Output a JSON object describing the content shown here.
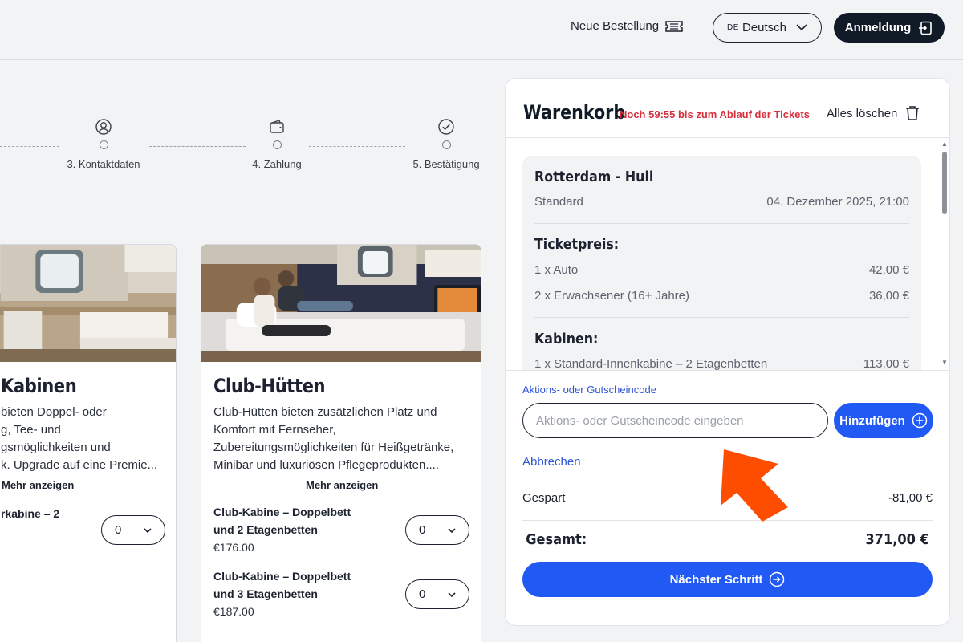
{
  "header": {
    "new_order_label": "Neue Bestellung",
    "lang_code": "DE",
    "lang_label": "Deutsch",
    "login_label": "Anmeldung"
  },
  "stepper": {
    "steps": [
      {
        "label": "3. Kontaktdaten",
        "icon": "user-circle-icon"
      },
      {
        "label": "4. Zahlung",
        "icon": "wallet-icon"
      },
      {
        "label": "5. Bestätigung",
        "icon": "check-circle-icon"
      }
    ]
  },
  "cards": [
    {
      "title": "Kabinen",
      "desc_lines": [
        "bieten Doppel- oder",
        "g, Tee- und",
        "gsmöglichkeiten und",
        "k. Upgrade auf eine Premie..."
      ],
      "more_label": "Mehr anzeigen",
      "option": {
        "name": "rkabine – 2",
        "qty": "0"
      }
    },
    {
      "title": "Club-Hütten",
      "desc_lines": [
        "Club-Hütten bieten zusätzlichen Platz und",
        "Komfort mit Fernseher,",
        "Zubereitungsmöglichkeiten für Heißgetränke,",
        "Minibar und luxuriösen Pflegeprodukten...."
      ],
      "more_label": "Mehr anzeigen",
      "options": [
        {
          "name_l1": "Club-Kabine – Doppelbett",
          "name_l2": "und 2 Etagenbetten",
          "price": "€176.00",
          "qty": "0"
        },
        {
          "name_l1": "Club-Kabine – Doppelbett",
          "name_l2": "und 3 Etagenbetten",
          "price": "€187.00",
          "qty": "0"
        }
      ]
    }
  ],
  "cart": {
    "title": "Warenkorb",
    "timer": "Noch 59:55 bis zum Ablauf der Tickets",
    "clear_all": "Alles löschen",
    "route": "Rotterdam - Hull",
    "fare": "Standard",
    "departure": "04. Dezember 2025, 21:00",
    "ticket_heading": "Ticketpreis:",
    "ticket_items": [
      {
        "label": "1 x Auto",
        "price": "42,00 €"
      },
      {
        "label": "2 x Erwachsener (16+ Jahre)",
        "price": "36,00 €"
      }
    ],
    "cabin_heading": "Kabinen:",
    "cabin_items": [
      {
        "label": "1 x Standard-Innenkabine – 2 Etagenbetten",
        "price": "113,00 €"
      }
    ],
    "promo_label": "Aktions- oder Gutscheincode",
    "promo_placeholder": "Aktions- oder Gutscheincode eingeben",
    "add_label": "Hinzufügen",
    "cancel_label": "Abbrechen",
    "saved_label": "Gespart",
    "saved_value": "-81,00 €",
    "total_label": "Gesamt:",
    "total_value": "371,00 €",
    "next_label": "Nächster Schritt"
  },
  "colors": {
    "accent": "#2159f5",
    "warning": "#d6303c",
    "annotation_arrow": "#ff4d00",
    "dark": "#111a27"
  }
}
